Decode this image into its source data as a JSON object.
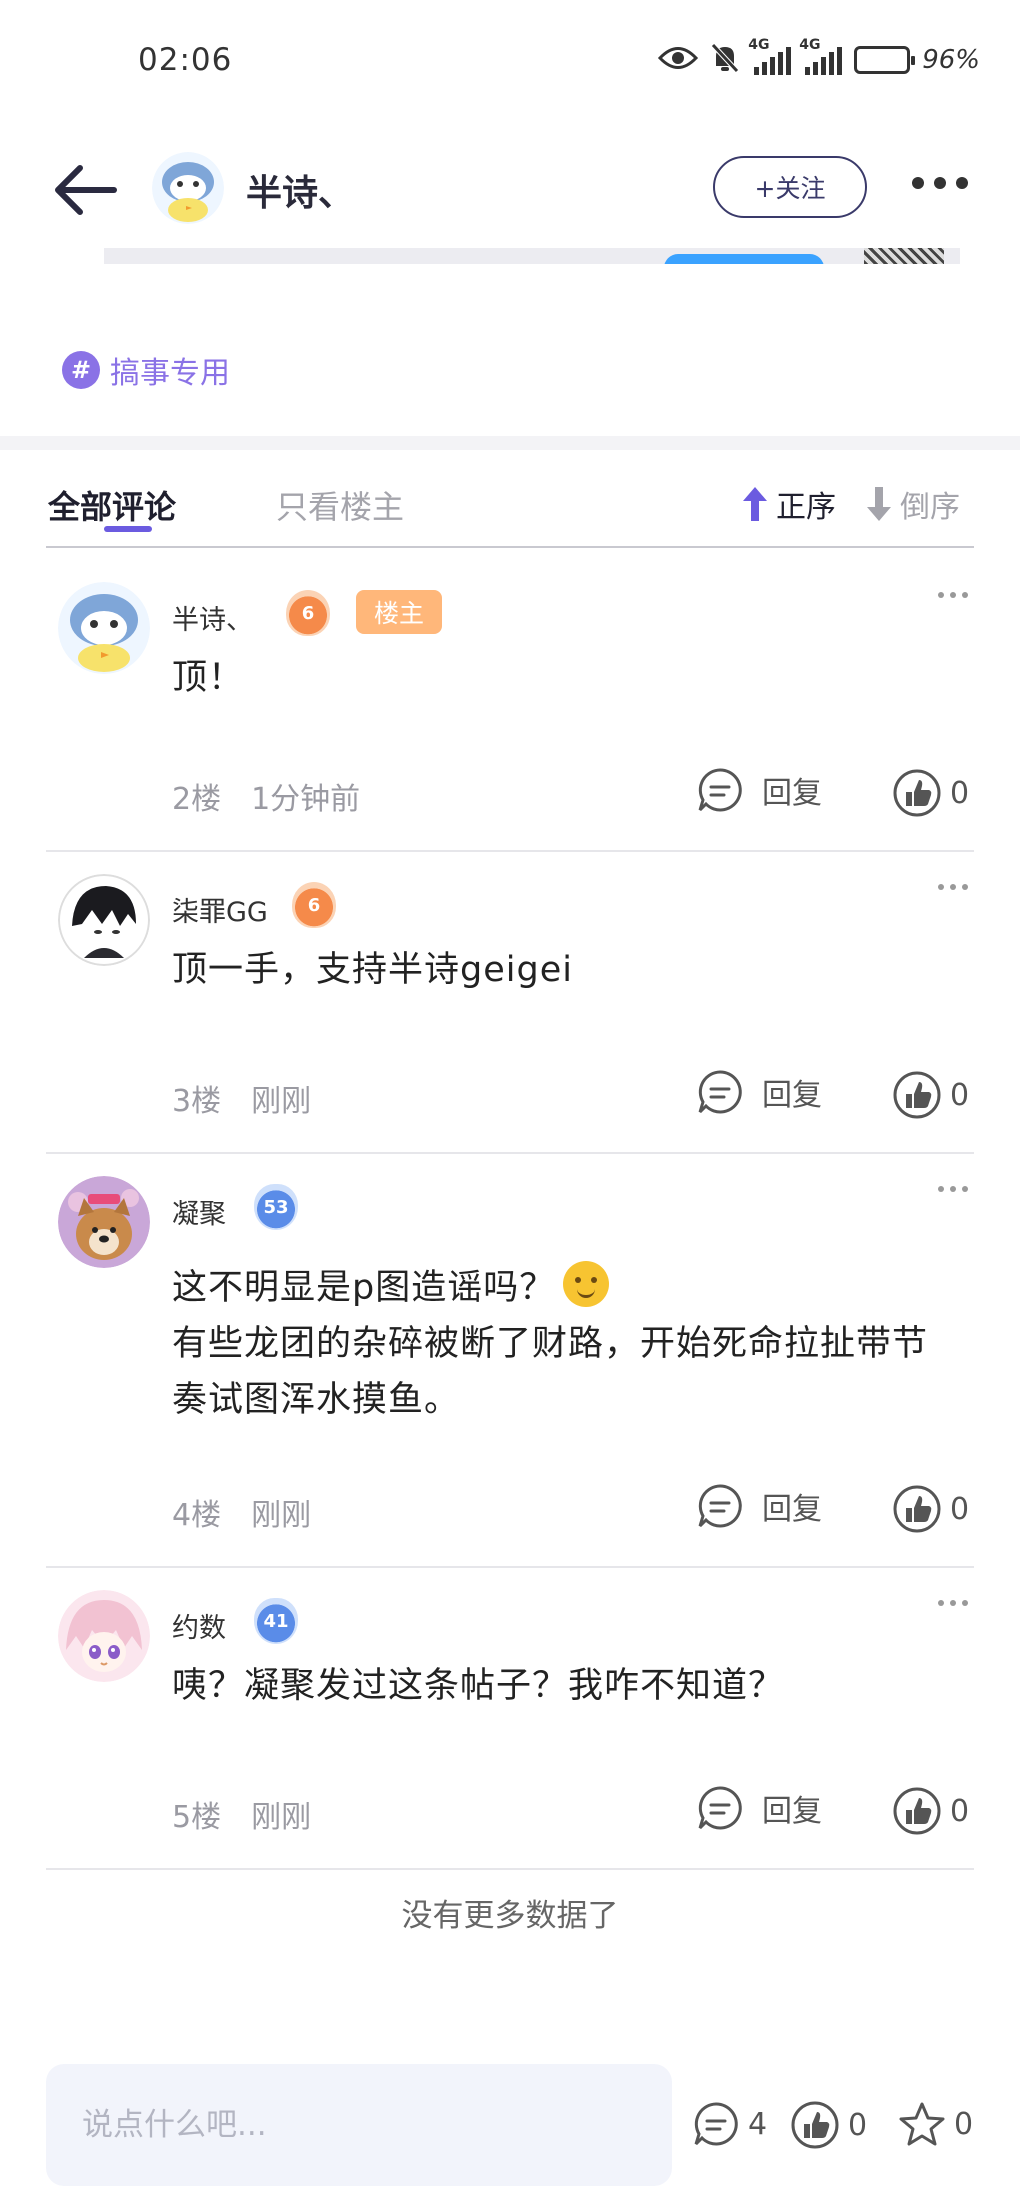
{
  "status_bar": {
    "time": "02:06",
    "network_1": "4G",
    "network_2": "4G",
    "battery": "96%"
  },
  "header": {
    "author_name": "半诗、",
    "follow_label": "+关注"
  },
  "topic": {
    "icon": "#",
    "label": "搞事专用"
  },
  "tabs": {
    "all": "全部评论",
    "owner_only": "只看楼主",
    "sort_asc": "正序",
    "sort_desc": "倒序"
  },
  "comments": [
    {
      "name": "半诗、",
      "level": "6",
      "badge": "楼主",
      "text": "顶！",
      "floor": "2楼",
      "time": "1分钟前",
      "reply_label": "回复",
      "likes": "0"
    },
    {
      "name": "柒罪GG",
      "level": "6",
      "text": "顶一手，支持半诗geigei",
      "floor": "3楼",
      "time": "刚刚",
      "reply_label": "回复",
      "likes": "0"
    },
    {
      "name": "凝聚",
      "level": "53",
      "text_line1": "这不明显是p图造谣吗？",
      "text_line2": "有些龙团的杂碎被断了财路，开始死命拉扯带节奏试图浑水摸鱼。",
      "emoji": "thinking-face",
      "floor": "4楼",
      "time": "刚刚",
      "reply_label": "回复",
      "likes": "0"
    },
    {
      "name": "约数",
      "level": "41",
      "text": "咦？凝聚发过这条帖子？我咋不知道？",
      "floor": "5楼",
      "time": "刚刚",
      "reply_label": "回复",
      "likes": "0"
    }
  ],
  "no_more": "没有更多数据了",
  "bottom_bar": {
    "input_placeholder": "说点什么吧...",
    "comment_count": "4",
    "like_count": "0",
    "favorite_count": "0"
  },
  "colors": {
    "accent": "#6b5be0",
    "topic": "#8a72e6",
    "owner_badge": "#ffb77a",
    "level_orange": "#f58a4a",
    "level_blue": "#5a8ce8"
  }
}
